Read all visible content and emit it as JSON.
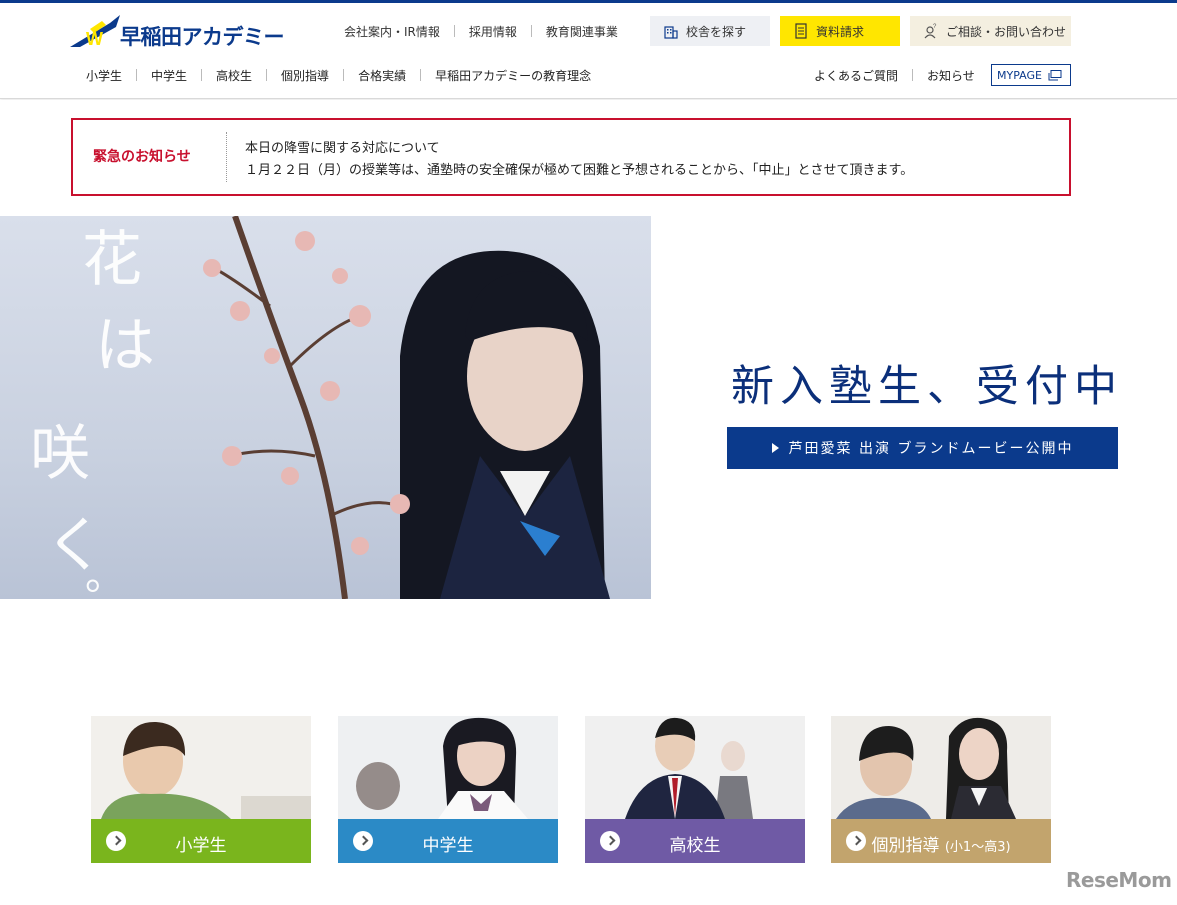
{
  "header": {
    "logo_text": "早稲田アカデミー",
    "util_links": [
      "会社案内・IR情報",
      "採用情報",
      "教育関連事業"
    ],
    "btn_school": "校舎を探す",
    "btn_request": "資料請求",
    "btn_consult": "ご相談・お問い合わせ",
    "main_nav": [
      "小学生",
      "中学生",
      "高校生",
      "個別指導",
      "合格実績",
      "早稲田アカデミーの教育理念"
    ],
    "sub_nav": [
      "よくあるご質問",
      "お知らせ"
    ],
    "mypage": "MYPAGE"
  },
  "alert": {
    "label": "緊急のお知らせ",
    "line1": "本日の降雪に関する対応について",
    "line2": "１月２２日（月）の授業等は、通塾時の安全確保が極めて困難と予想されることから、「中止」とさせて頂きます。"
  },
  "hero": {
    "headline": "新入塾生、受付中",
    "cta": "芦田愛菜 出演 ブランドムービー公開中",
    "calligraphy": [
      "花",
      "は",
      "咲",
      "く",
      "。"
    ]
  },
  "cards": [
    {
      "label": "小学生",
      "sub": "",
      "color": "#7ab51d"
    },
    {
      "label": "中学生",
      "sub": "",
      "color": "#2b8ac6"
    },
    {
      "label": "高校生",
      "sub": "",
      "color": "#6f5aa5"
    },
    {
      "label": "個別指導",
      "sub": "(小1〜高3)",
      "color": "#c2a46d"
    }
  ],
  "colors": {
    "brand": "#0b3a8c",
    "alert": "#c8102e",
    "request": "#ffe600"
  },
  "watermark": "ReseMom"
}
